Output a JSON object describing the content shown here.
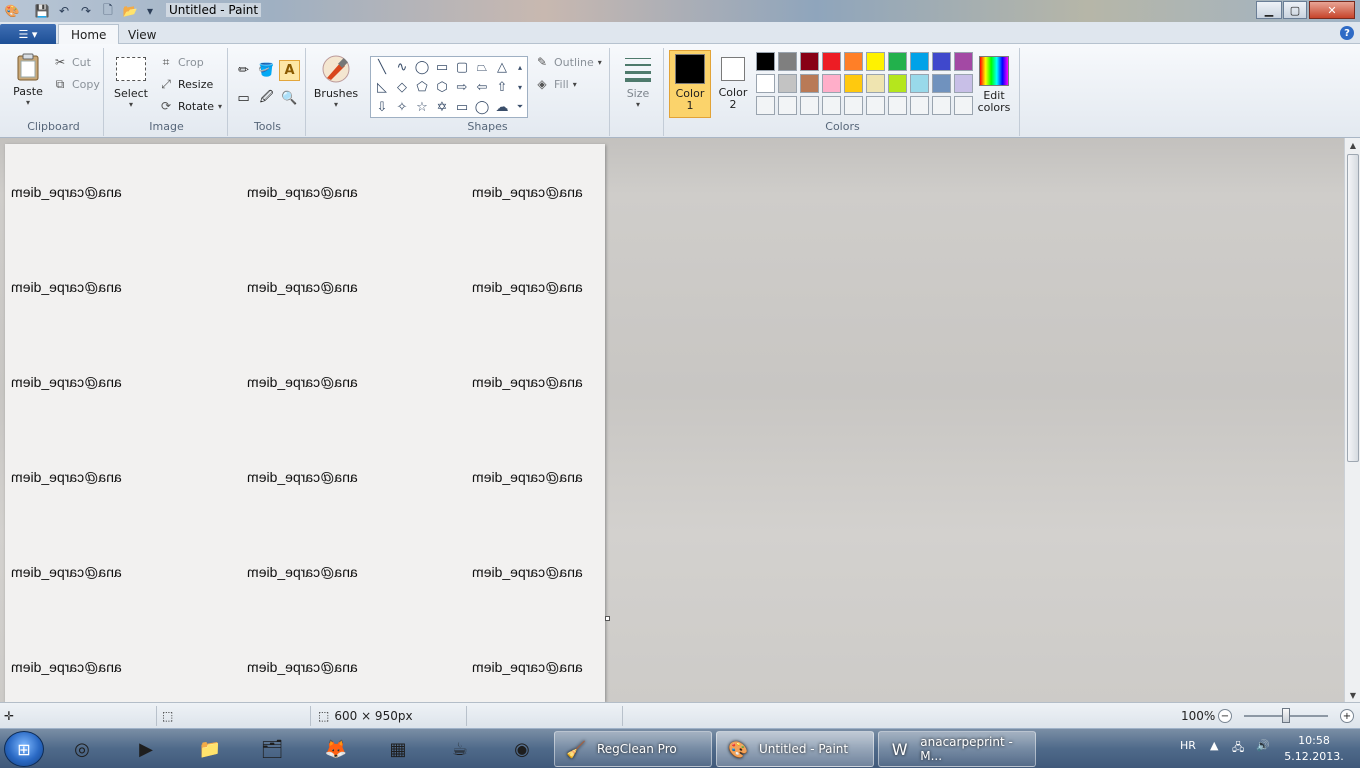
{
  "window": {
    "title": "Untitled - Paint",
    "controls": {
      "minimize": "▁",
      "maximize": "▢",
      "close": "✕"
    }
  },
  "quick_access": [
    "paint-icon",
    "save-icon",
    "undo-icon",
    "redo-icon",
    "new-icon",
    "open-icon",
    "customize-icon"
  ],
  "tabs": [
    {
      "label": "Home",
      "active": true
    },
    {
      "label": "View",
      "active": false
    }
  ],
  "ribbon": {
    "clipboard": {
      "group": "Clipboard",
      "paste": "Paste",
      "cut": "Cut",
      "copy": "Copy"
    },
    "image": {
      "group": "Image",
      "select": "Select",
      "crop": "Crop",
      "resize": "Resize",
      "rotate": "Rotate"
    },
    "tools": {
      "group": "Tools",
      "active_tool": "text"
    },
    "brushes": {
      "label": "Brushes"
    },
    "shapes": {
      "group": "Shapes",
      "outline": "Outline",
      "fill": "Fill"
    },
    "size": {
      "label": "Size"
    },
    "colors": {
      "group": "Colors",
      "color1_label": "Color",
      "color1_num": "1",
      "color2_label": "Color",
      "color2_num": "2",
      "color1": "#000000",
      "color2": "#ffffff",
      "edit_label": "Edit",
      "edit_label2": "colors",
      "palette_row1": [
        "#000000",
        "#7f7f7f",
        "#880015",
        "#ed1c24",
        "#ff7f27",
        "#fff200",
        "#22b14c",
        "#00a2e8",
        "#3f48cc",
        "#a349a4"
      ],
      "palette_row2": [
        "#ffffff",
        "#c3c3c3",
        "#b97a57",
        "#ffaec9",
        "#ffc90e",
        "#efe4b0",
        "#b5e61d",
        "#99d9ea",
        "#7092be",
        "#c8bfe7"
      ]
    }
  },
  "canvas": {
    "text": "ana@carpe_diem"
  },
  "status": {
    "canvas_size": "600 × 950px",
    "zoom": "100%"
  },
  "taskbar": {
    "windows": [
      {
        "label": "RegClean Pro"
      },
      {
        "label": "Untitled - Paint"
      },
      {
        "label": "anacarpeprint - M..."
      }
    ],
    "language": "HR",
    "time": "10:58",
    "date": "5.12.2013."
  }
}
